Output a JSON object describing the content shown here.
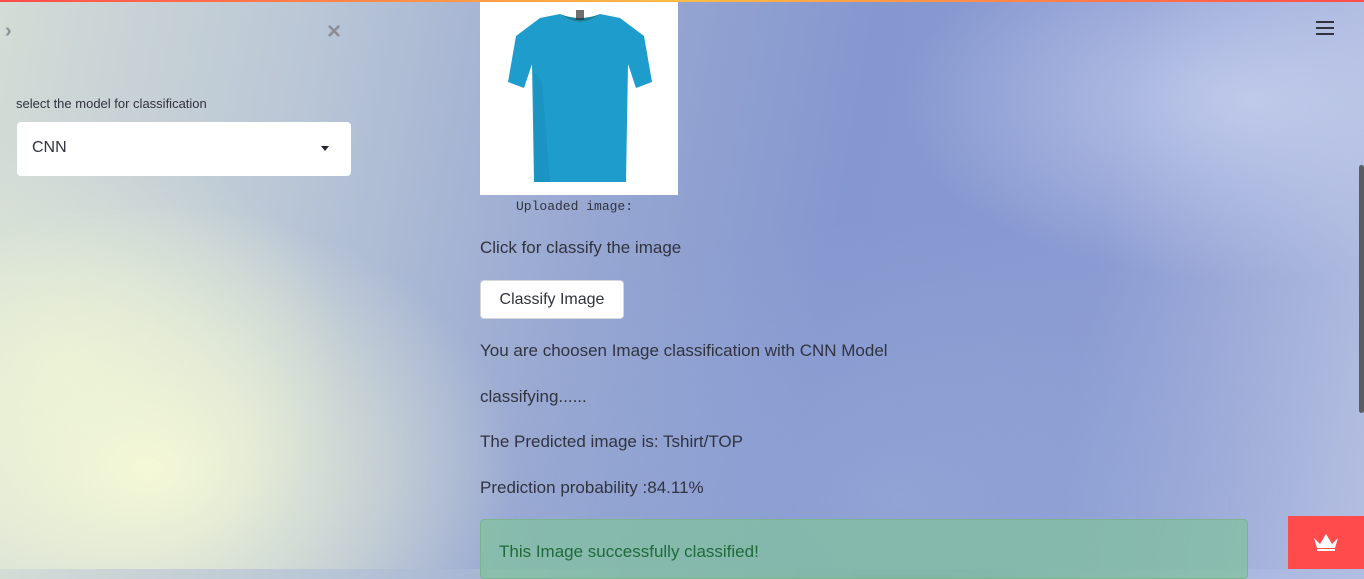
{
  "sidebar": {
    "select_label": "select the model for classification",
    "selected_model": "CNN",
    "open_icon": "chevron-right-icon",
    "close_icon": "close-icon"
  },
  "main": {
    "image_caption": "Uploaded image:",
    "click_prompt": "Click for classify the image",
    "classify_button": "Classify Image",
    "chosen_text": "You are choosen Image classification with CNN Model",
    "classifying_text": "classifying......",
    "predicted_text": "The Predicted image is: Tshirt/TOP",
    "probability_text": "Prediction probability :84.11%",
    "success_text": "This Image successfully classified!"
  },
  "header": {
    "menu_icon": "hamburger-menu-icon"
  },
  "colors": {
    "accent": "#ff4b4b",
    "tshirt": "#1e9ccc",
    "success_bg": "#81c29c"
  }
}
